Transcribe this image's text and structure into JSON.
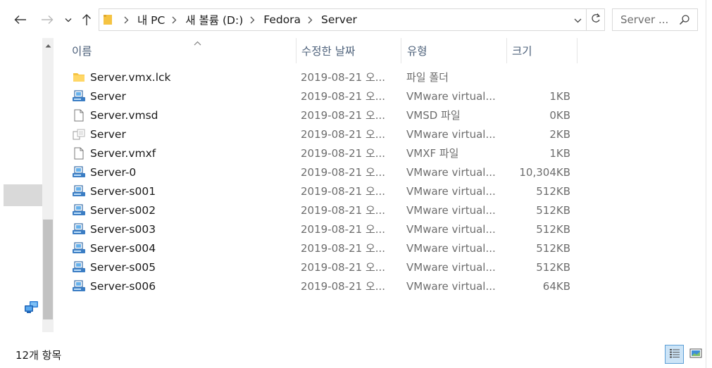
{
  "navigation": {
    "back_icon": "arrow-left-icon",
    "forward_icon": "arrow-right-icon",
    "recent_icon": "chevron-down-icon",
    "up_icon": "arrow-up-icon"
  },
  "address_bar": {
    "crumbs": [
      "내 PC",
      "새 볼륨 (D:)",
      "Fedora",
      "Server"
    ],
    "dropdown_icon": "chevron-down-icon",
    "refresh_icon": "refresh-icon"
  },
  "search": {
    "placeholder": "Server ...",
    "icon": "search-icon"
  },
  "columns": {
    "name": "이름",
    "date": "수정한 날짜",
    "type": "유형",
    "size": "크기"
  },
  "files": [
    {
      "name": "Server.vmx.lck",
      "date": "2019-08-21 오...",
      "type": "파일 폴더",
      "size": "",
      "icon": "folder-icon"
    },
    {
      "name": "Server",
      "date": "2019-08-21 오...",
      "type": "VMware virtual...",
      "size": "1KB",
      "icon": "vmware-file-icon"
    },
    {
      "name": "Server.vmsd",
      "date": "2019-08-21 오...",
      "type": "VMSD 파일",
      "size": "0KB",
      "icon": "blank-file-icon"
    },
    {
      "name": "Server",
      "date": "2019-08-21 오...",
      "type": "VMware virtual...",
      "size": "2KB",
      "icon": "vmware-config-icon"
    },
    {
      "name": "Server.vmxf",
      "date": "2019-08-21 오...",
      "type": "VMXF 파일",
      "size": "1KB",
      "icon": "blank-file-icon"
    },
    {
      "name": "Server-0",
      "date": "2019-08-21 오...",
      "type": "VMware virtual...",
      "size": "10,304KB",
      "icon": "vmware-disk-icon"
    },
    {
      "name": "Server-s001",
      "date": "2019-08-21 오...",
      "type": "VMware virtual...",
      "size": "512KB",
      "icon": "vmware-disk-icon"
    },
    {
      "name": "Server-s002",
      "date": "2019-08-21 오...",
      "type": "VMware virtual...",
      "size": "512KB",
      "icon": "vmware-disk-icon"
    },
    {
      "name": "Server-s003",
      "date": "2019-08-21 오...",
      "type": "VMware virtual...",
      "size": "512KB",
      "icon": "vmware-disk-icon"
    },
    {
      "name": "Server-s004",
      "date": "2019-08-21 오...",
      "type": "VMware virtual...",
      "size": "512KB",
      "icon": "vmware-disk-icon"
    },
    {
      "name": "Server-s005",
      "date": "2019-08-21 오...",
      "type": "VMware virtual...",
      "size": "512KB",
      "icon": "vmware-disk-icon"
    },
    {
      "name": "Server-s006",
      "date": "2019-08-21 오...",
      "type": "VMware virtual...",
      "size": "64KB",
      "icon": "vmware-disk-icon"
    }
  ],
  "status": {
    "item_count": "12개 항목"
  },
  "view_buttons": {
    "details_icon": "details-view-icon",
    "thumbnails_icon": "large-icons-view-icon"
  },
  "colors": {
    "header_text": "#4c607a",
    "secondary_text": "#6d6d6d",
    "folder_yellow": "#f5c342",
    "selection_blue": "#cce4f7",
    "nav_selected": "#d9d9d9"
  }
}
